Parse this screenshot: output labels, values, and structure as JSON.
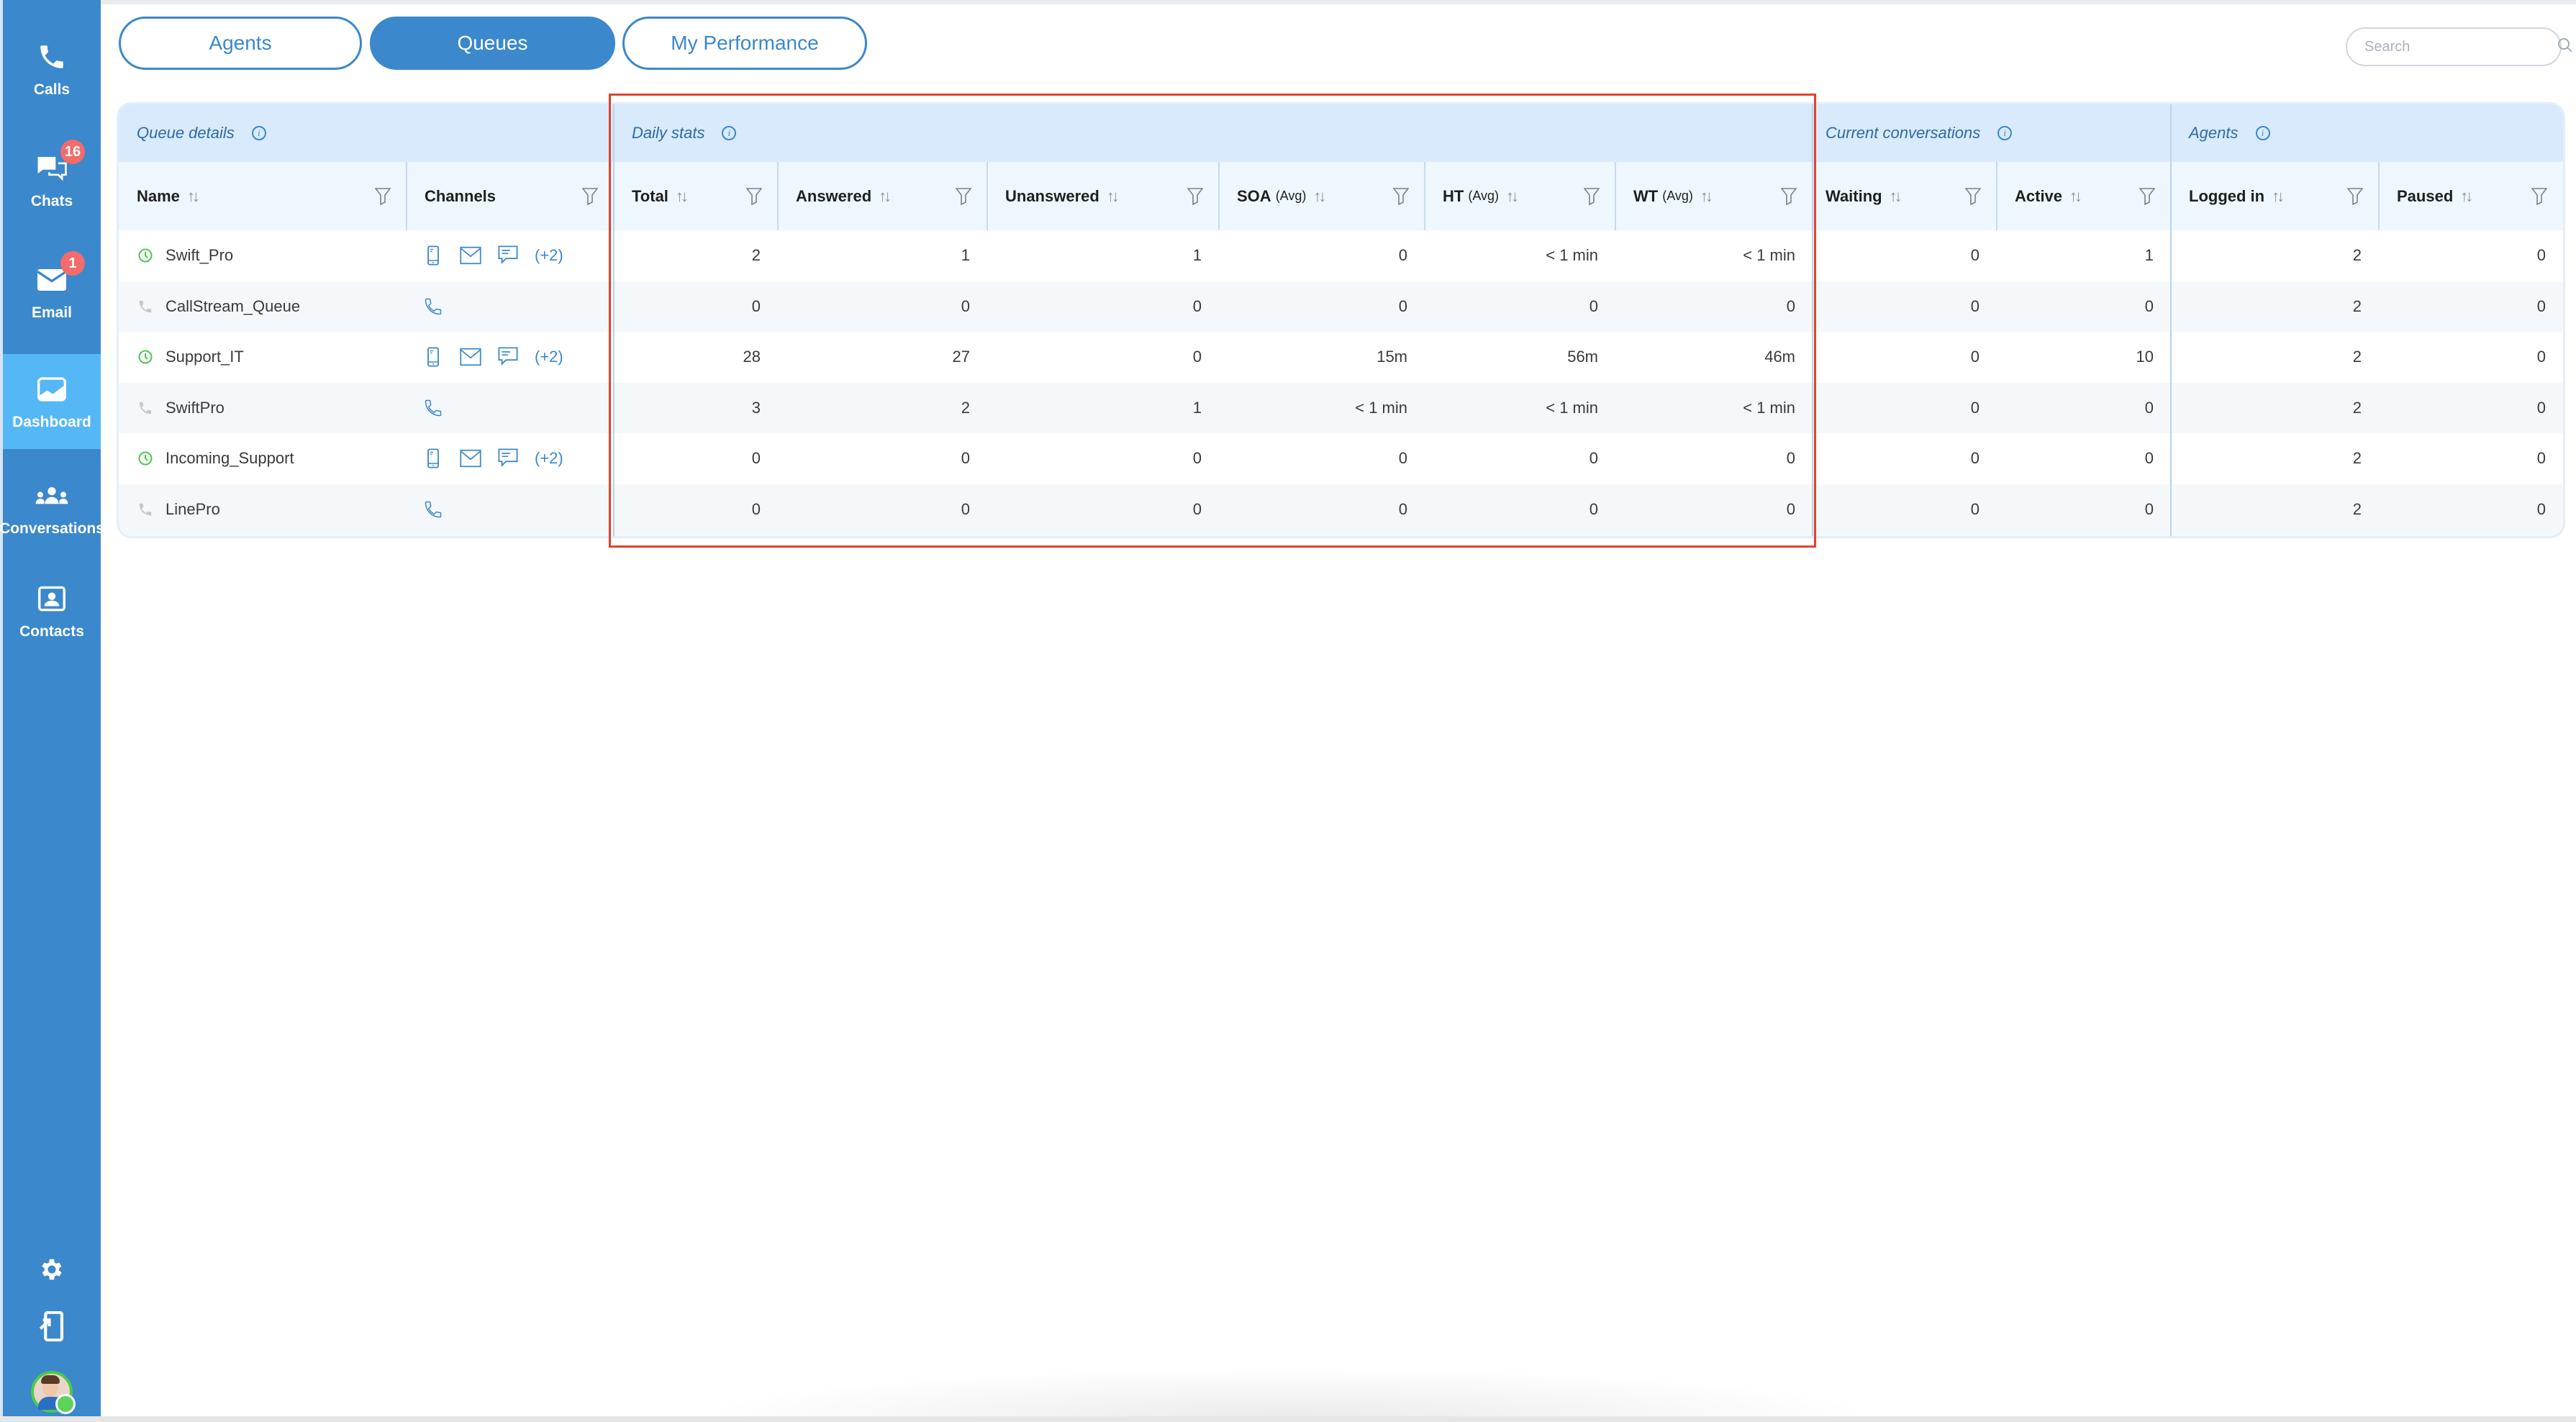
{
  "sidebar": {
    "items": [
      {
        "label": "Calls",
        "icon": "phone-icon",
        "badge": null,
        "active": false
      },
      {
        "label": "Chats",
        "icon": "chat-bubbles-icon",
        "badge": "16",
        "active": false
      },
      {
        "label": "Email",
        "icon": "envelope-icon",
        "badge": "1",
        "active": false
      },
      {
        "label": "Dashboard",
        "icon": "dashboard-chart-icon",
        "badge": null,
        "active": true
      },
      {
        "label": "Conversations",
        "icon": "group-users-icon",
        "badge": null,
        "active": false
      },
      {
        "label": "Contacts",
        "icon": "contact-card-icon",
        "badge": null,
        "active": false
      }
    ],
    "bottom_icons": [
      "gear-icon",
      "device-transfer-icon",
      "user-avatar"
    ],
    "user_status": "online"
  },
  "tabs": [
    {
      "label": "Agents",
      "active": false
    },
    {
      "label": "Queues",
      "active": true
    },
    {
      "label": "My Performance",
      "active": false
    }
  ],
  "search": {
    "placeholder": "Search",
    "value": ""
  },
  "table": {
    "groups": [
      {
        "label": "Queue details",
        "info_icon": true
      },
      {
        "label": "Daily stats",
        "info_icon": true
      },
      {
        "label": "Current conversations",
        "info_icon": true
      },
      {
        "label": "Agents",
        "info_icon": true
      }
    ],
    "columns": [
      {
        "label": "Name",
        "sub": "",
        "sortable": true,
        "filter": true
      },
      {
        "label": "Channels",
        "sub": "",
        "sortable": false,
        "filter": true
      },
      {
        "label": "Total",
        "sub": "",
        "sortable": true,
        "filter": true
      },
      {
        "label": "Answered",
        "sub": "",
        "sortable": true,
        "filter": true
      },
      {
        "label": "Unanswered",
        "sub": "",
        "sortable": true,
        "filter": true
      },
      {
        "label": "SOA",
        "sub": "(Avg)",
        "sortable": true,
        "filter": true
      },
      {
        "label": "HT",
        "sub": "(Avg)",
        "sortable": true,
        "filter": true
      },
      {
        "label": "WT",
        "sub": "(Avg)",
        "sortable": true,
        "filter": true
      },
      {
        "label": "Waiting",
        "sub": "",
        "sortable": true,
        "filter": true
      },
      {
        "label": "Active",
        "sub": "",
        "sortable": true,
        "filter": true
      },
      {
        "label": "Logged in",
        "sub": "",
        "sortable": true,
        "filter": true
      },
      {
        "label": "Paused",
        "sub": "",
        "sortable": true,
        "filter": true
      }
    ],
    "rows": [
      {
        "name": "Swift_Pro",
        "type_icon": "clock-icon",
        "channels": [
          "mobile-icon",
          "envelope-icon",
          "chat-icon"
        ],
        "more": "(+2)",
        "values": [
          "2",
          "1",
          "1",
          "0",
          "< 1 min",
          "< 1 min",
          "0",
          "1",
          "2",
          "0"
        ]
      },
      {
        "name": "CallStream_Queue",
        "type_icon": "phone-icon",
        "channels": [
          "phone-icon"
        ],
        "more": "",
        "values": [
          "0",
          "0",
          "0",
          "0",
          "0",
          "0",
          "0",
          "0",
          "2",
          "0"
        ]
      },
      {
        "name": "Support_IT",
        "type_icon": "clock-icon",
        "channels": [
          "mobile-icon",
          "envelope-icon",
          "chat-icon"
        ],
        "more": "(+2)",
        "values": [
          "28",
          "27",
          "0",
          "15m",
          "56m",
          "46m",
          "0",
          "10",
          "2",
          "0"
        ]
      },
      {
        "name": "SwiftPro",
        "type_icon": "phone-icon",
        "channels": [
          "phone-icon"
        ],
        "more": "",
        "values": [
          "3",
          "2",
          "1",
          "< 1 min",
          "< 1 min",
          "< 1 min",
          "0",
          "0",
          "2",
          "0"
        ]
      },
      {
        "name": "Incoming_Support",
        "type_icon": "clock-icon",
        "channels": [
          "mobile-icon",
          "envelope-icon",
          "chat-icon"
        ],
        "more": "(+2)",
        "values": [
          "0",
          "0",
          "0",
          "0",
          "0",
          "0",
          "0",
          "0",
          "2",
          "0"
        ]
      },
      {
        "name": "LinePro",
        "type_icon": "phone-icon",
        "channels": [
          "phone-icon"
        ],
        "more": "",
        "values": [
          "0",
          "0",
          "0",
          "0",
          "0",
          "0",
          "0",
          "0",
          "2",
          "0"
        ]
      }
    ]
  },
  "colors": {
    "primary": "#3b88cc",
    "sidebar_active": "#56b7f7",
    "badge": "#f46b6b",
    "group_header_bg": "#d8eafc",
    "column_header_bg": "#eef6fe",
    "queue_active_green": "#4cc94a",
    "highlight_red": "#e2422b"
  }
}
